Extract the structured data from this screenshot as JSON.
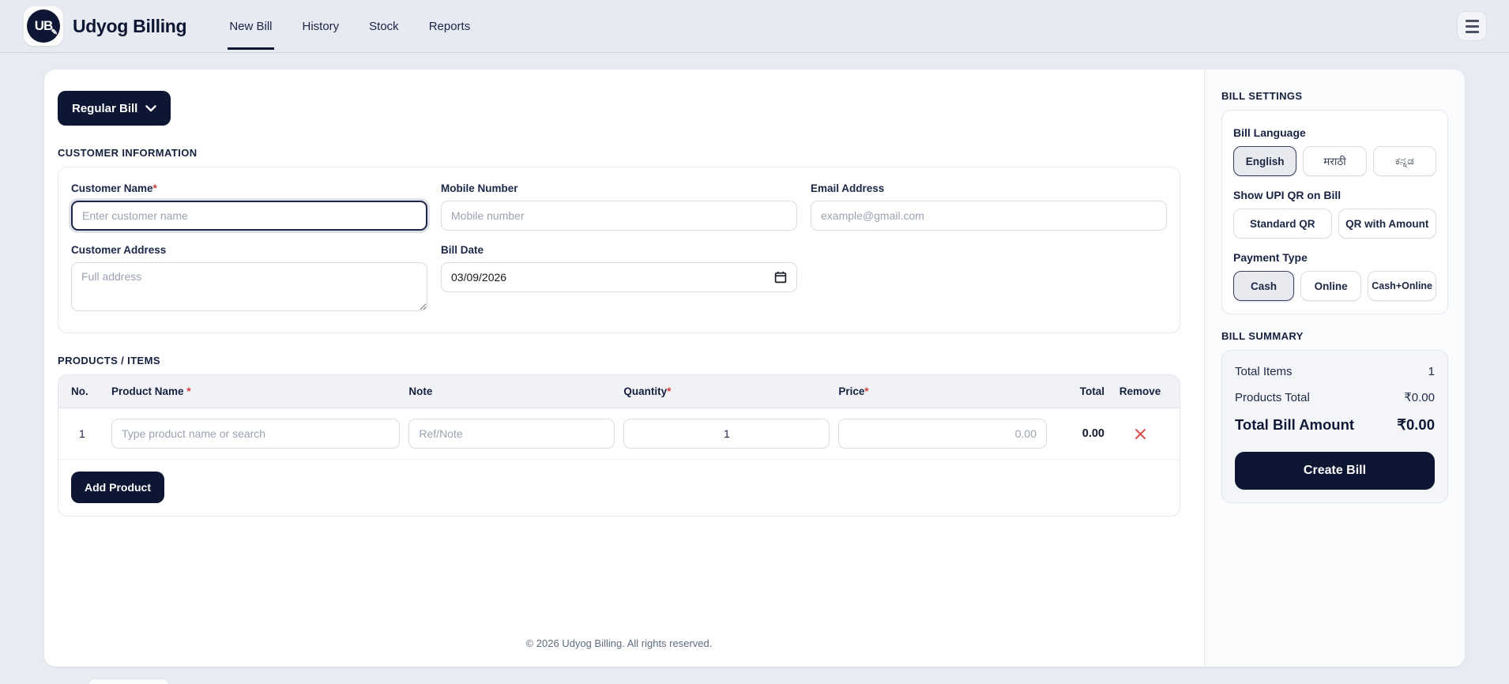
{
  "header": {
    "logo_text": "UB",
    "brand": "Udyog Billing",
    "nav": {
      "new_bill": "New Bill",
      "history": "History",
      "stock": "Stock",
      "reports": "Reports"
    }
  },
  "main": {
    "bill_type_button": "Regular Bill",
    "customer_section_title": "CUSTOMER INFORMATION",
    "required_mark": "*",
    "customer_name_label": "Customer Name",
    "customer_name_placeholder": "Enter customer name",
    "mobile_label": "Mobile Number",
    "mobile_placeholder": "Mobile number",
    "email_label": "Email Address",
    "email_placeholder": "example@gmail.com",
    "address_label": "Customer Address",
    "address_placeholder": "Full address",
    "bill_date_label": "Bill Date",
    "bill_date_value": "03/09/2026",
    "products_section_title": "PRODUCTS / ITEMS",
    "table": {
      "col_no": "No.",
      "col_product": "Product Name",
      "col_note": "Note",
      "col_quantity": "Quantity",
      "col_price": "Price",
      "col_total": "Total",
      "col_remove": "Remove",
      "rows": [
        {
          "no": "1",
          "product_placeholder": "Type product name or search",
          "note_placeholder": "Ref/Note",
          "quantity": "1",
          "price_placeholder": "0.00",
          "total": "0.00"
        }
      ]
    },
    "add_product_button": "Add Product",
    "footer": "© 2026 Udyog Billing. All rights reserved."
  },
  "sidebar": {
    "settings_title": "BILL SETTINGS",
    "language_label": "Bill Language",
    "languages": [
      {
        "label": "English",
        "selected": true
      },
      {
        "label": "मराठी",
        "selected": false
      },
      {
        "label": "ಕನ್ನಡ",
        "selected": false
      }
    ],
    "upi_label": "Show UPI QR on Bill",
    "upi_options": [
      {
        "label": "Standard QR",
        "selected": false
      },
      {
        "label": "QR with Amount",
        "selected": false
      }
    ],
    "payment_label": "Payment Type",
    "payment_options": [
      {
        "label": "Cash",
        "selected": true
      },
      {
        "label": "Online",
        "selected": false
      },
      {
        "label": "Cash+Online",
        "selected": false
      }
    ],
    "summary_title": "BILL SUMMARY",
    "summary": {
      "total_items_label": "Total Items",
      "total_items_value": "1",
      "products_total_label": "Products Total",
      "products_total_value": "₹0.00",
      "total_bill_label": "Total Bill Amount",
      "total_bill_value": "₹0.00"
    },
    "create_bill_button": "Create Bill"
  },
  "colors": {
    "navy": "#0d1633",
    "danger": "#d03c3c",
    "page_bg": "#e9ebf2"
  }
}
